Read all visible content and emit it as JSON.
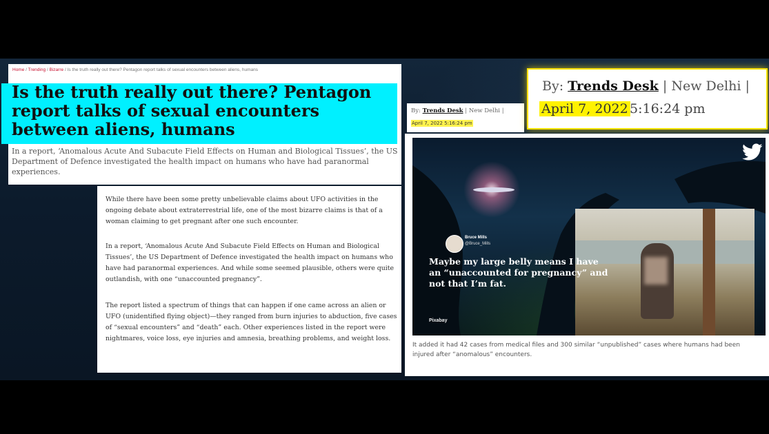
{
  "breadcrumb": {
    "items": [
      "Home",
      "Trending",
      "Bizarre"
    ],
    "separator": "/",
    "current": "Is the truth really out there? Pentagon report talks of sexual encounters between aliens, humans"
  },
  "article": {
    "headline": "Is the truth really out there? Pentagon report talks of sexual encounters between aliens, humans",
    "standfirst": "In a report, ‘Anomalous Acute And Subacute Field Effects on Human and Biological Tissues’, the US Department of Defence investigated the health impact on humans who have had paranormal experiences.",
    "paragraphs": [
      "While there have been some pretty unbelievable claims about UFO activities in the ongoing debate about extraterrestrial life, one of the most bizarre claims is that of a woman claiming to get pregnant after one such encounter.",
      "In a report, ‘Anomalous Acute And Subacute Field Effects on Human and Biological Tissues’, the US Department of Defence investigated the health impact on humans who have had paranormal experiences. And while some seemed plausible, others were quite outlandish, with one “unaccounted pregnancy”.",
      "The report listed a spectrum of things that can happen if one came across an alien or UFO (unidentified flying object)—they ranged from burn injuries to abduction, five cases of “sexual encounters” and “death” each. Other experiences listed in the report were nightmares, voice loss, eye injuries and amnesia, breathing problems, and weight loss."
    ]
  },
  "byline": {
    "prefix": "By:",
    "author": "Trends Desk",
    "sep": "|",
    "location": "New Delhi",
    "date": "April 7, 2022",
    "time": "5:16:24 pm",
    "date_time": "April 7, 2022 5:16:24 pm"
  },
  "image": {
    "tweet_name": "Bruce Mills",
    "tweet_handle": "@Bruce_Mills",
    "tweet_text": "Maybe my large belly means I have an “unaccounted for pregnancy” and not that I’m fat.",
    "credit": "Pixabay",
    "icon": "twitter-bird-icon"
  },
  "caption": "It added it had 42 cases from medical files and 300 similar “unpublished” cases where humans had been injured after “anomalous” encounters.",
  "colors": {
    "headline_highlight": "#00f0ff",
    "date_highlight": "#fff200",
    "callout_border": "#ffe400",
    "link_red": "#c8102e"
  }
}
